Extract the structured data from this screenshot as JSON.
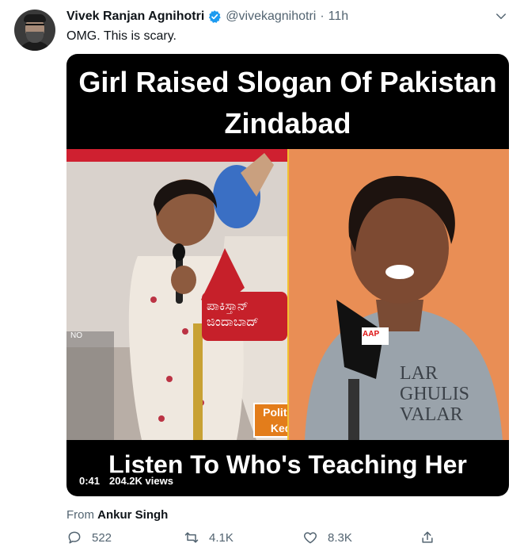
{
  "tweet": {
    "author_name": "Vivek Ranjan Agnihotri",
    "handle": "@vivekagnihotri",
    "dot": "·",
    "time": "11h",
    "text": "OMG. This is scary.",
    "media": {
      "title": "Girl Raised Slogan Of Pakistan Zindabad",
      "caption": "Listen To Who's Teaching Her",
      "speech_bubble": "ಪಾಕಿಸ್ತಾನ್ ಜಿಂದಾಬಾದ್",
      "logo": "Political Keda",
      "shirt_text": "LAR GHULIS VALAR",
      "mic_label": "AAP",
      "duration": "0:41",
      "views": "204.2K views"
    },
    "from_label": "From",
    "from_user": "Ankur Singh",
    "actions": {
      "replies": "522",
      "retweets": "4.1K",
      "likes": "8.3K"
    }
  },
  "colors": {
    "verified": "#1d9bf0",
    "secondary_text": "#536471"
  },
  "icons": [
    "verified-badge-icon",
    "caret-down-icon",
    "reply-icon",
    "retweet-icon",
    "like-icon",
    "share-icon"
  ]
}
